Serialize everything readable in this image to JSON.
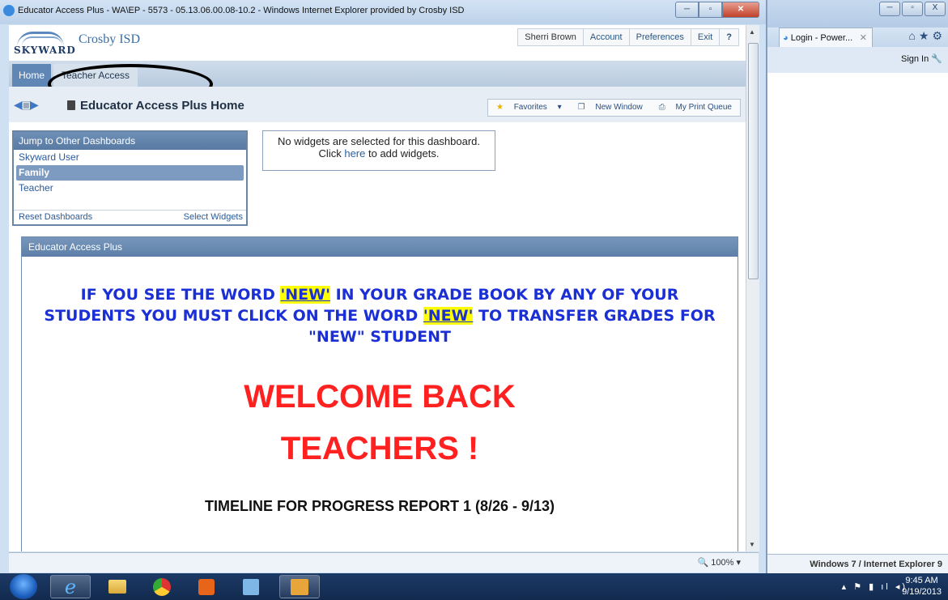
{
  "main_window": {
    "title": "Educator Access Plus - WA\\EP - 5573 - 05.13.06.00.08-10.2 - Windows Internet Explorer provided by Crosby ISD",
    "zoom": "100%"
  },
  "skyward": {
    "logo_text": "SKYWARD",
    "district": "Crosby ISD",
    "topnav": {
      "user": "Sherri Brown",
      "account": "Account",
      "preferences": "Preferences",
      "exit": "Exit",
      "help": "?"
    },
    "tabs": {
      "home": "Home",
      "teacher_access": "Teacher Access"
    },
    "page_title": "Educator Access Plus Home",
    "toolbar": {
      "favorites": "Favorites",
      "new_window": "New Window",
      "print_queue": "My Print Queue"
    },
    "jump_panel": {
      "header": "Jump to Other Dashboards",
      "items": [
        "Skyward User",
        "Family",
        "Teacher"
      ],
      "reset": "Reset Dashboards",
      "select": "Select Widgets"
    },
    "no_widgets": {
      "line1": "No widgets are selected for this dashboard.",
      "click": "Click",
      "here": "here",
      "rest": "to add widgets."
    },
    "eap_panel": {
      "header": "Educator Access Plus",
      "notice_a": "IF YOU SEE THE WORD",
      "new_word": "'NEW'",
      "notice_b": "IN YOUR GRADE BOOK BY ANY OF YOUR STUDENTS YOU MUST CLICK ON THE WORD",
      "notice_c": "TO TRANSFER GRADES FOR \"NEW\" STUDENT",
      "welcome_1": "WELCOME BACK",
      "welcome_2": "TEACHERS !",
      "timeline": "TIMELINE FOR PROGRESS REPORT 1 (8/26 - 9/13)"
    }
  },
  "background_window": {
    "tab_title": "Login - Power...",
    "sign_in": "Sign In",
    "status": "Windows 7 / Internet Explorer 9"
  },
  "taskbar": {
    "time": "9:45 AM",
    "date": "9/19/2013"
  }
}
